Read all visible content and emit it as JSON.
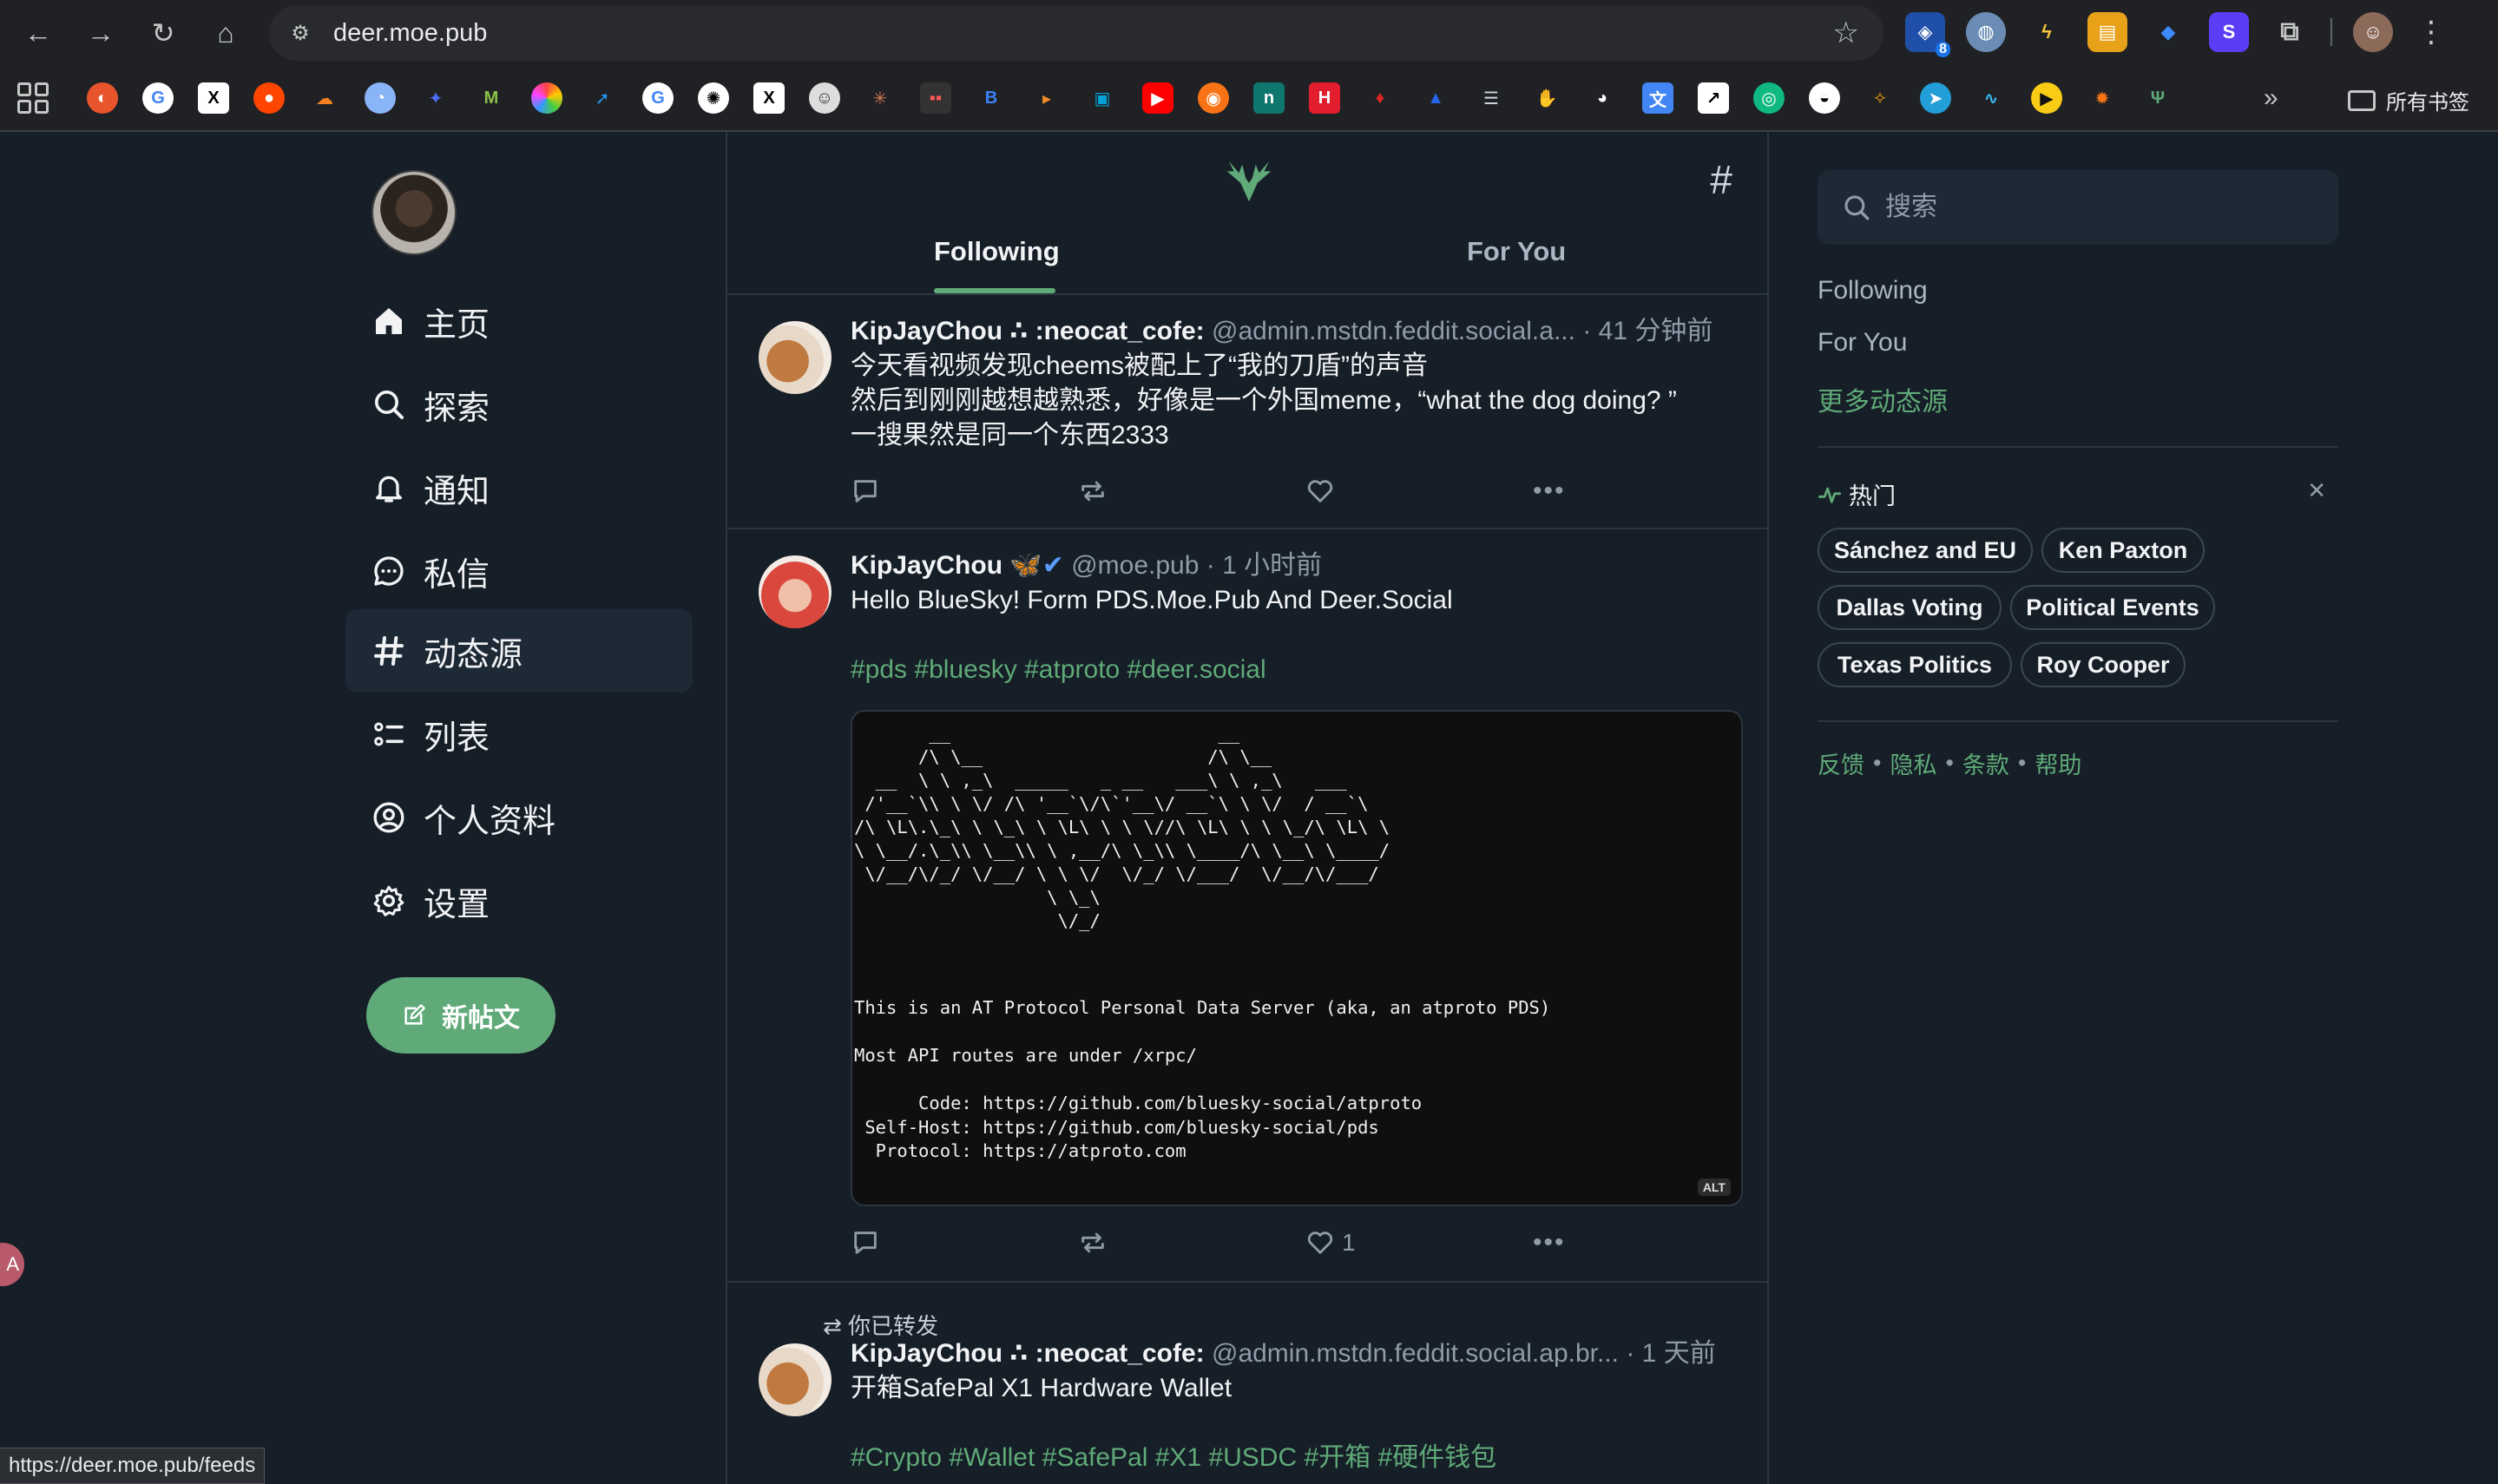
{
  "browser": {
    "url": "deer.moe.pub",
    "extension_badge": "8",
    "bookmarks_folder": "所有书签",
    "status_url": "https://deer.moe.pub/feeds"
  },
  "nav": {
    "items": [
      {
        "label": "主页",
        "icon": "home-icon"
      },
      {
        "label": "探索",
        "icon": "search-icon"
      },
      {
        "label": "通知",
        "icon": "bell-icon"
      },
      {
        "label": "私信",
        "icon": "chat-icon"
      },
      {
        "label": "动态源",
        "icon": "hash-icon"
      },
      {
        "label": "列表",
        "icon": "list-icon"
      },
      {
        "label": "个人资料",
        "icon": "profile-icon"
      },
      {
        "label": "设置",
        "icon": "gear-icon"
      }
    ],
    "active": "动态源",
    "compose_label": "新帖文"
  },
  "feed": {
    "tabs": [
      "Following",
      "For You"
    ],
    "active_tab": "Following",
    "posts": [
      {
        "name": "KipJayChou",
        "flair": "∴ :neocat_cofe:",
        "handle": "@admin.mstdn.feddit.social.a...",
        "time": "· 41 分钟前",
        "lines": [
          "今天看视频发现cheems被配上了“我的刀盾”的声音",
          "然后到刚刚越想越熟悉，好像是一个外国meme，“what the dog doing? ”",
          "一搜果然是同一个东西2333"
        ],
        "likes": ""
      },
      {
        "name": "KipJayChou",
        "flair": "🦋✔",
        "handle": "@moe.pub",
        "time": "· 1 小时前",
        "lines": [
          "Hello BlueSky! Form PDS.Moe.Pub And Deer.Social"
        ],
        "tags": "#pds #bluesky #atproto #deer.social",
        "embed_info": "This is an AT Protocol Personal Data Server (aka, an atproto PDS)\n\nMost API routes are under /xrpc/\n\n      Code: https://github.com/bluesky-social/atproto\n Self-Host: https://github.com/bluesky-social/pds\n  Protocol: https://atproto.com",
        "alt": "ALT",
        "likes": "1"
      },
      {
        "repost_note": "你已转发",
        "name": "KipJayChou",
        "flair": "∴ :neocat_cofe:",
        "handle": "@admin.mstdn.feddit.social.ap.br...",
        "time": "· 1 天前",
        "lines": [
          "开箱SafePal X1 Hardware Wallet"
        ],
        "tags": "#Crypto #Wallet #SafePal #X1 #USDC #开箱 #硬件钱包"
      }
    ]
  },
  "sidebar": {
    "search_placeholder": "搜索",
    "links": [
      "Following",
      "For You"
    ],
    "more_link": "更多动态源",
    "trending_title": "热门",
    "trends": [
      "Sánchez and EU",
      "Ken Paxton",
      "Dallas Voting",
      "Political Events",
      "Texas Politics",
      "Roy Cooper"
    ],
    "footer": [
      "反馈",
      "隐私",
      "条款",
      "帮助"
    ]
  },
  "colors": {
    "accent": "#5faa78",
    "background": "#161e27",
    "muted_text": "#8f9ba8"
  }
}
